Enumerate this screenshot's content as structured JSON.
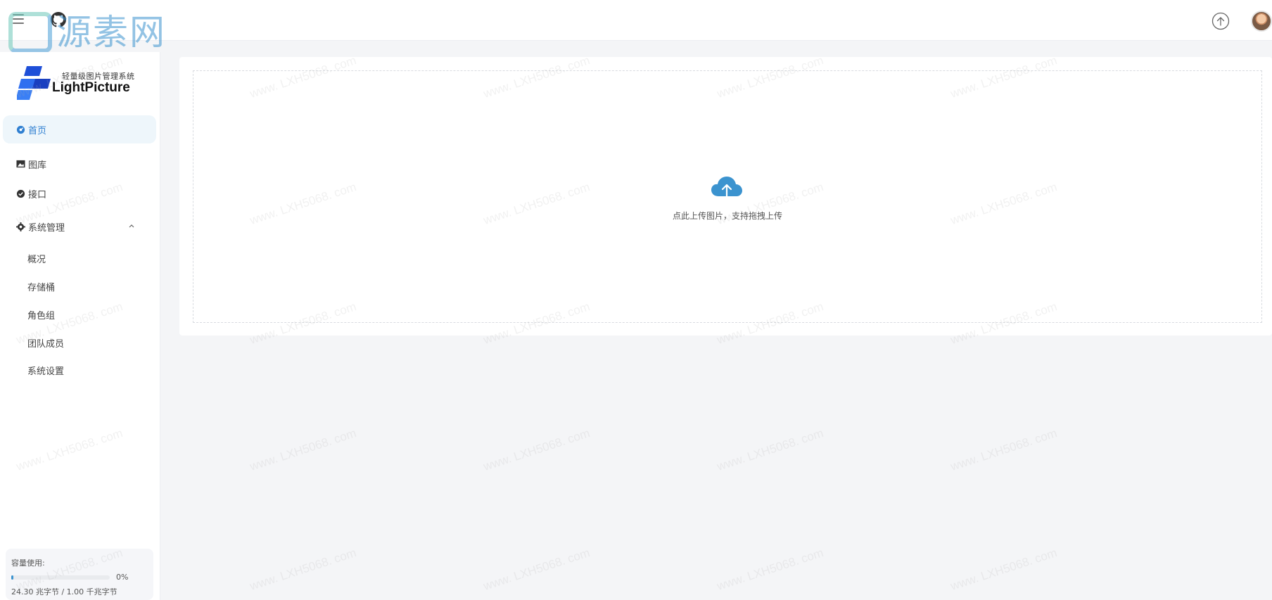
{
  "header": {
    "watermark_text": "源素网",
    "menu_icon": "hamburger-icon",
    "github_icon": "github-icon",
    "upload_icon": "upload-arrow-icon",
    "avatar_icon": "user-avatar"
  },
  "sidebar": {
    "logo_subtitle": "轻量级图片管理系统",
    "logo_brand": "LightPicture",
    "items": [
      {
        "label": "首页",
        "icon": "dashboard-icon",
        "active": true
      },
      {
        "label": "图库",
        "icon": "image-icon",
        "active": false
      },
      {
        "label": "接口",
        "icon": "api-icon",
        "active": false
      },
      {
        "label": "系统管理",
        "icon": "gear-icon",
        "active": false,
        "expanded": true
      }
    ],
    "sub_items": [
      {
        "label": "概况"
      },
      {
        "label": "存储桶"
      },
      {
        "label": "角色组"
      },
      {
        "label": "团队成员"
      },
      {
        "label": "系统设置"
      }
    ],
    "storage": {
      "label": "容量使用:",
      "percent_text": "0%",
      "percent": 0.02,
      "usage_text": "24.30 兆字节 / 1.00 千兆字节"
    }
  },
  "main": {
    "upload_hint": "点此上传图片，支持拖拽上传",
    "cloud_icon": "cloud-upload-icon"
  },
  "watermark": "www. LXH5068. com",
  "colors": {
    "accent": "#3b93cf",
    "active_bg": "#eef6fb",
    "page_bg": "#f4f5f7"
  }
}
